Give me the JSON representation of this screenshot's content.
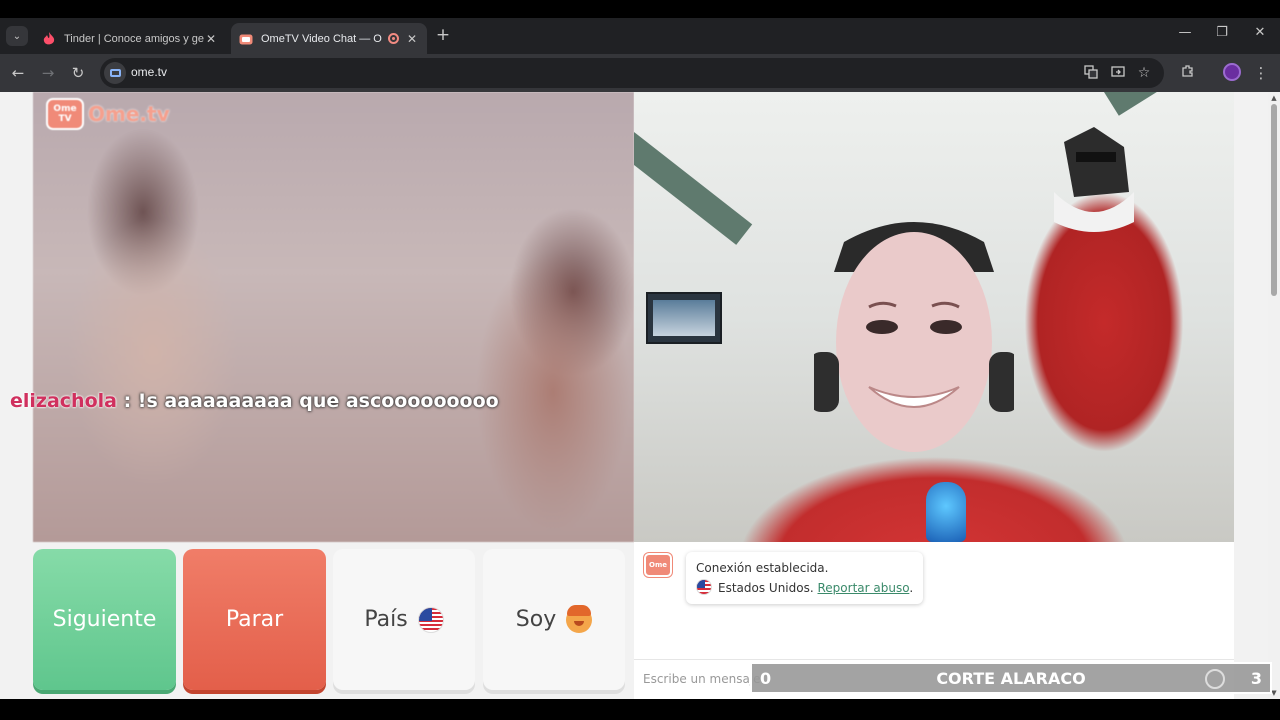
{
  "browser": {
    "tabs": [
      {
        "title": "Tinder | Conoce amigos y gente",
        "active": false
      },
      {
        "title": "OmeTV Video Chat — Ome",
        "active": true
      }
    ],
    "new_tab_glyph": "+",
    "url": "ome.tv",
    "icons": [
      "back-icon",
      "forward-icon",
      "reload-icon",
      "translate-icon",
      "cast-icon",
      "star-icon",
      "extensions-icon",
      "profile-avatar",
      "menu-icon"
    ]
  },
  "site": {
    "logo_badge_line1": "Ome",
    "logo_badge_line2": "TV",
    "logo_text": "Ome.tv"
  },
  "overlay_chat": {
    "username": "elizachola",
    "message": " : !s aaaaaaaaaa que ascooooooooo"
  },
  "controls": {
    "next_label": "Siguiente",
    "stop_label": "Parar",
    "country_label": "País",
    "soy_label": "Soy"
  },
  "chat": {
    "status": "Conexión establecida.",
    "country": "Estados Unidos.",
    "report_link": "Reportar abuso",
    "report_suffix": ".",
    "input_placeholder": "Escribe un mensaje"
  },
  "score_overlay": {
    "left": "0",
    "title": "CORTE ALARACO",
    "right": "3"
  },
  "colors": {
    "next_button": "#6ccf97",
    "stop_button": "#e86a55",
    "brand": "#f08a78",
    "link": "#3a8a6a"
  }
}
